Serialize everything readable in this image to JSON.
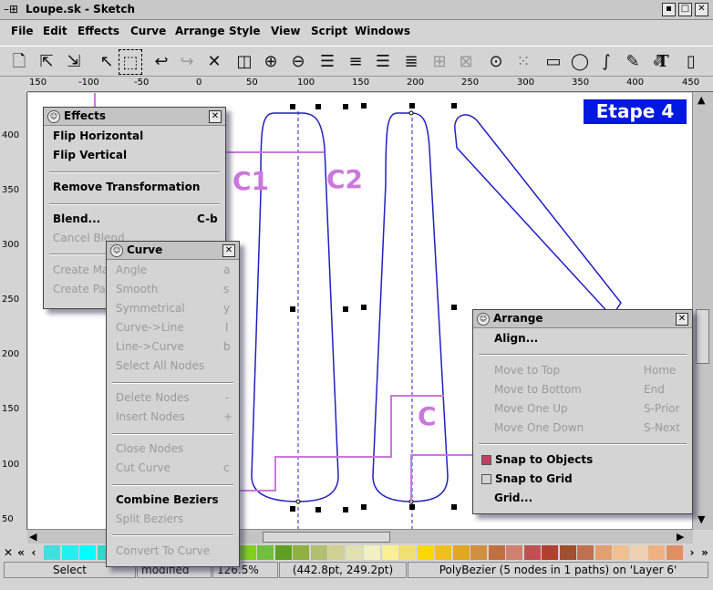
{
  "window": {
    "title": "Loupe.sk - Sketch"
  },
  "menubar": [
    "File",
    "Edit",
    "Effects",
    "Curve",
    "Arrange",
    "Style",
    "View",
    "Script",
    "Windows"
  ],
  "toolbar_icons": [
    "new-file-icon",
    "open-file-icon",
    "save-file-icon",
    "edit-tool-icon",
    "select-tool-icon",
    "undo-icon",
    "redo-icon",
    "delete-icon",
    "flip-h-icon",
    "flip-v-icon",
    "rotate-icon",
    "align-left-icon",
    "align-center-icon",
    "align-right-icon",
    "align-justify-icon",
    "group-icon",
    "ungroup-icon",
    "zoom-icon",
    "grid-icon",
    "rectangle-tool-icon",
    "ellipse-tool-icon",
    "bezier-tool-icon",
    "freehand-tool-icon",
    "pen-tool-icon",
    "text-tool-icon",
    "layers-icon"
  ],
  "hruler_labels": [
    "150",
    "-100",
    "-50",
    "0",
    "50",
    "100",
    "150",
    "200",
    "250",
    "300",
    "350",
    "400",
    "450"
  ],
  "vruler_labels": [
    "400",
    "350",
    "300",
    "250",
    "200",
    "150",
    "100",
    "50"
  ],
  "etape": "Etape 4",
  "callouts": {
    "c1": "C1",
    "c2": "C2",
    "c": "C"
  },
  "effects": {
    "title": "Effects",
    "items": [
      {
        "label": "Flip Horizontal",
        "shortcut": "",
        "enabled": true
      },
      {
        "label": "Flip Vertical",
        "shortcut": "",
        "enabled": true
      },
      {
        "label": "Remove Transformation",
        "shortcut": "",
        "enabled": true
      },
      {
        "label": "Blend...",
        "shortcut": "C-b",
        "enabled": true
      },
      {
        "label": "Cancel Blend",
        "shortcut": "",
        "enabled": false
      },
      {
        "label": "Create Ma",
        "shortcut": "",
        "enabled": false
      },
      {
        "label": "Create Pa",
        "shortcut": "",
        "enabled": false
      }
    ]
  },
  "curve": {
    "title": "Curve",
    "items": [
      {
        "label": "Angle",
        "shortcut": "a",
        "enabled": false
      },
      {
        "label": "Smooth",
        "shortcut": "s",
        "enabled": false
      },
      {
        "label": "Symmetrical",
        "shortcut": "y",
        "enabled": false
      },
      {
        "label": "Curve->Line",
        "shortcut": "l",
        "enabled": false
      },
      {
        "label": "Line->Curve",
        "shortcut": "b",
        "enabled": false
      },
      {
        "label": "Select All Nodes",
        "shortcut": "",
        "enabled": false
      },
      {
        "label": "Delete Nodes",
        "shortcut": "-",
        "enabled": false
      },
      {
        "label": "Insert Nodes",
        "shortcut": "+",
        "enabled": false
      },
      {
        "label": "Close Nodes",
        "shortcut": "",
        "enabled": false
      },
      {
        "label": "Cut Curve",
        "shortcut": "c",
        "enabled": false
      },
      {
        "label": "Combine Beziers",
        "shortcut": "",
        "enabled": true
      },
      {
        "label": "Split Beziers",
        "shortcut": "",
        "enabled": false
      },
      {
        "label": "Convert To Curve",
        "shortcut": "",
        "enabled": false
      }
    ]
  },
  "arrange": {
    "title": "Arrange",
    "items": [
      {
        "label": "Align...",
        "shortcut": "",
        "enabled": true
      },
      {
        "label": "Move to Top",
        "shortcut": "Home",
        "enabled": false
      },
      {
        "label": "Move to Bottom",
        "shortcut": "End",
        "enabled": false
      },
      {
        "label": "Move One Up",
        "shortcut": "S-Prior",
        "enabled": false
      },
      {
        "label": "Move One Down",
        "shortcut": "S-Next",
        "enabled": false
      },
      {
        "label": "Snap to Objects",
        "shortcut": "",
        "enabled": true,
        "checked": true
      },
      {
        "label": "Snap to Grid",
        "shortcut": "",
        "enabled": true,
        "checked": false
      },
      {
        "label": "Grid...",
        "shortcut": "",
        "enabled": true
      }
    ]
  },
  "palette_colors": [
    "#40e0e0",
    "#20f0f0",
    "#00ffff",
    "#30d8c8",
    "#50e0a0",
    "#40f080",
    "#20ff60",
    "#00ff40",
    "#20e040",
    "#40ff20",
    "#60e030",
    "#80d020",
    "#70c040",
    "#60a020",
    "#90b040",
    "#b0c070",
    "#d0d090",
    "#e0e0b0",
    "#f0f0c0",
    "#f8f090",
    "#f0e070",
    "#f8d800",
    "#f0c020",
    "#e0a820",
    "#d09040",
    "#c07040",
    "#d08070",
    "#c05050",
    "#b04030",
    "#a05030",
    "#c07050",
    "#e0a070",
    "#f0c090",
    "#f0d0b0",
    "#f0b080",
    "#e09060"
  ],
  "status": {
    "mode": "Select",
    "modified": "modified",
    "zoom": "126.5%",
    "coords": "(442.8pt, 249.2pt)",
    "selection": "PolyBezier (5 nodes in 1 paths) on 'Layer 6'"
  },
  "colors": {
    "path": "#2020c0",
    "callout": "#cc77dd",
    "etape_bg": "#0018e0"
  }
}
